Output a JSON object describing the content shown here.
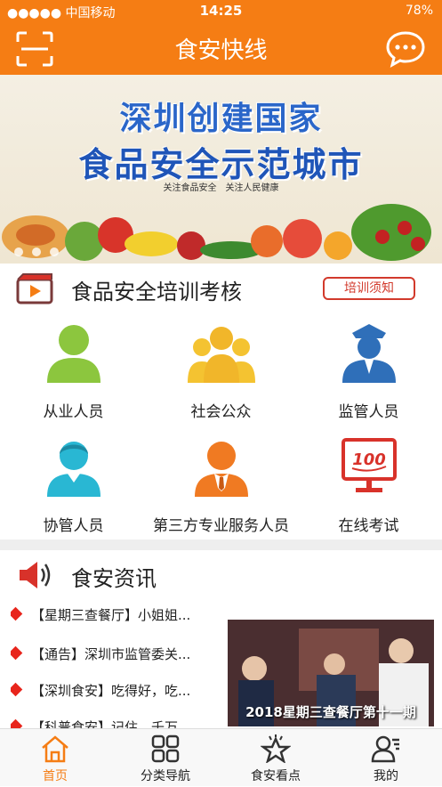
{
  "status_bar": {
    "carrier": "●●●●● 中国移动",
    "time": "14:25",
    "battery": "78%"
  },
  "nav": {
    "title": "食安快线",
    "scan_icon": "scan-icon",
    "message_icon": "chat-bubble-icon"
  },
  "banner": {
    "line1": "深圳创建国家",
    "line2": "食品安全示范城市",
    "tagline": "关注食品安全　关注人民健康"
  },
  "training": {
    "title": "食品安全培训考核",
    "notice_button": "培训须知",
    "items": [
      {
        "label": "从业人员",
        "icon": "person-icon",
        "color": "#8cc63e"
      },
      {
        "label": "社会公众",
        "icon": "group-icon",
        "color": "#f4c331"
      },
      {
        "label": "监管人员",
        "icon": "officer-icon",
        "color": "#2f6fb9"
      },
      {
        "label": "协管人员",
        "icon": "assistant-icon",
        "color": "#29b7d3"
      },
      {
        "label": "第三方专业服务人员",
        "icon": "professional-icon",
        "color": "#f07a22"
      },
      {
        "label": "在线考试",
        "icon": "exam-icon",
        "color": "#d8322a"
      }
    ]
  },
  "news": {
    "title": "食安资讯",
    "items": [
      "【星期三查餐厅】小姐姐...",
      "【通告】深圳市监管委关...",
      "【深圳食安】吃得好，吃...",
      "【科普食安】记住，千万..."
    ],
    "photo_caption": "2018星期三查餐厅第十一期"
  },
  "tabs": [
    {
      "label": "首页",
      "icon": "home-icon",
      "active": true
    },
    {
      "label": "分类导航",
      "icon": "grid-icon",
      "active": false
    },
    {
      "label": "食安看点",
      "icon": "star-icon",
      "active": false
    },
    {
      "label": "我的",
      "icon": "profile-icon",
      "active": false
    }
  ],
  "colors": {
    "brand": "#f57d14",
    "accent_red": "#d23a2c"
  }
}
